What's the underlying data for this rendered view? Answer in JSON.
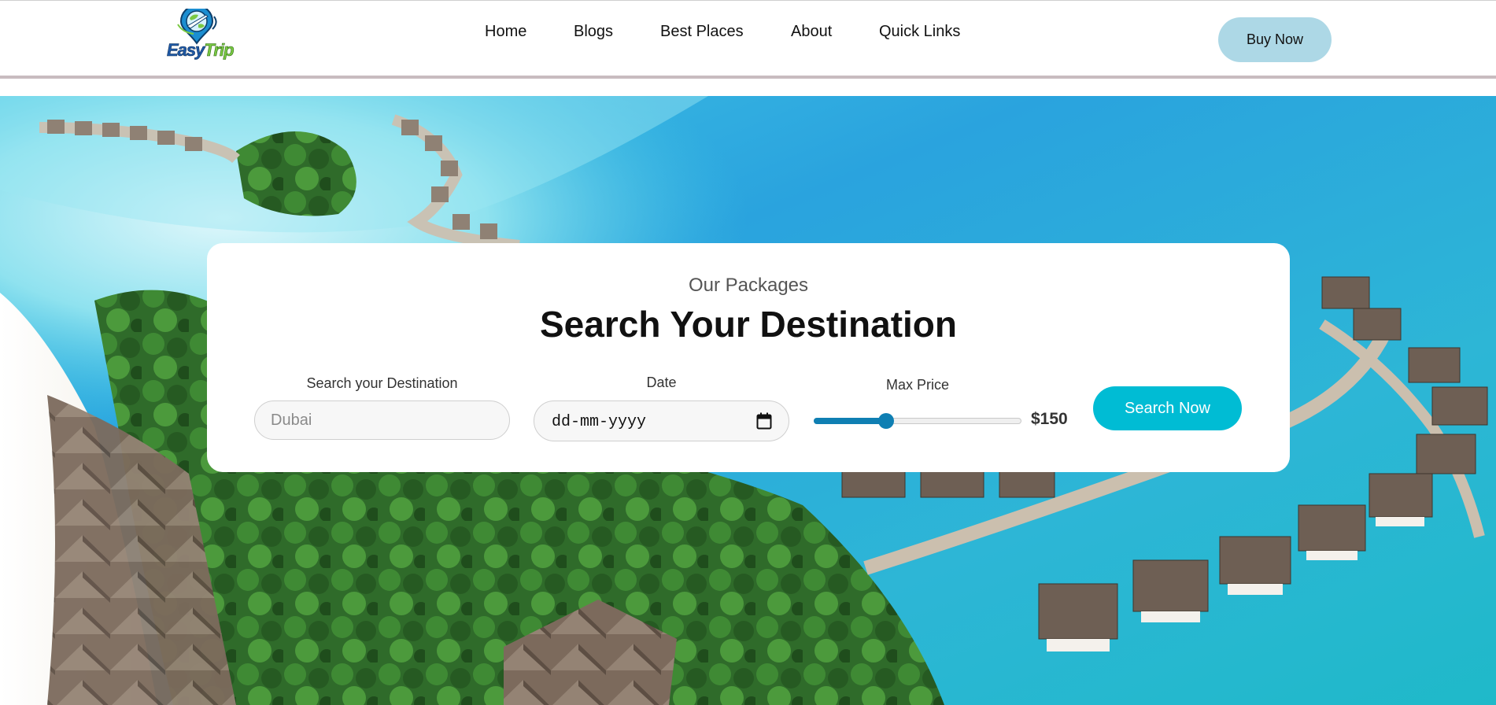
{
  "header": {
    "logo": {
      "word1": "Easy",
      "word2": "Trip",
      "icon": "globe-pin-plane-icon"
    },
    "nav": [
      {
        "label": "Home"
      },
      {
        "label": "Blogs"
      },
      {
        "label": "Best Places"
      },
      {
        "label": "About"
      },
      {
        "label": "Quick Links"
      }
    ],
    "buy_button": "Buy Now",
    "accent_color": "#add8e6"
  },
  "hero": {
    "background": "tropical-island-overwater-villas-photo"
  },
  "search": {
    "subtitle": "Our Packages",
    "title": "Search Your Destination",
    "destination": {
      "label": "Search your Destination",
      "placeholder": "Dubai",
      "value": ""
    },
    "date": {
      "label": "Date",
      "placeholder": "dd-mm-yyyy",
      "icon": "calendar-icon"
    },
    "price": {
      "label": "Max Price",
      "display": "$150",
      "level": 0.35
    },
    "button": "Search Now",
    "button_color": "#00bcd4",
    "slider_color": "#0f7fb3"
  }
}
